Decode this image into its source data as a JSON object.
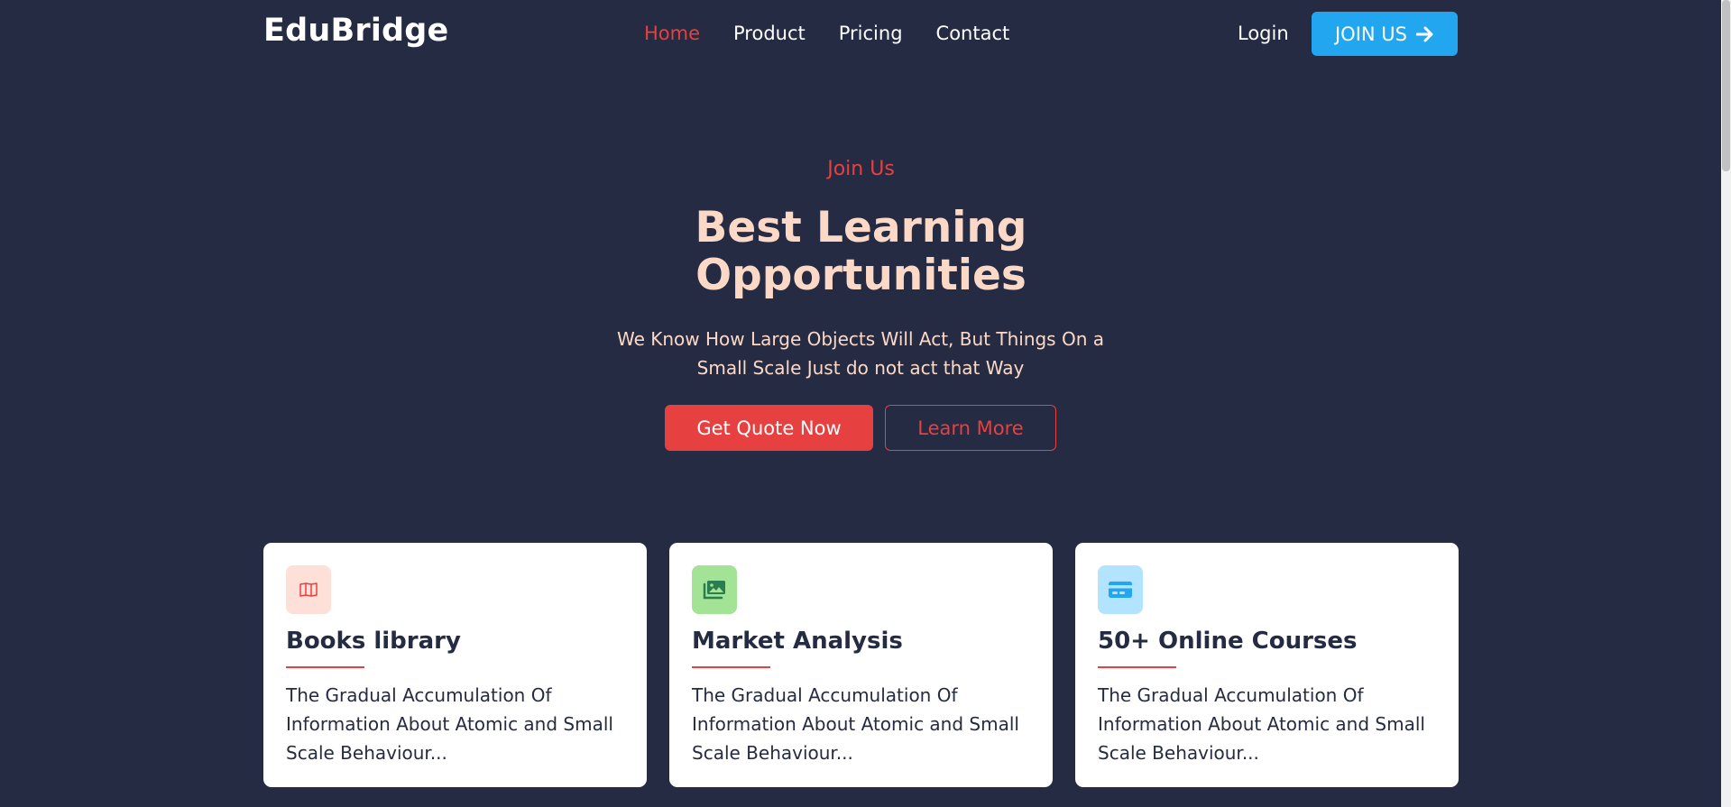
{
  "header": {
    "brand": "EduBridge",
    "nav": [
      "Home",
      "Product",
      "Pricing",
      "Contact"
    ],
    "active_nav": "Home",
    "login_label": "Login",
    "join_label": "JOIN US"
  },
  "hero": {
    "eyebrow": "Join Us",
    "title_line1": "Best Learning",
    "title_line2": "Opportunities",
    "subtitle_line1": "We Know How Large Objects Will Act, But Things On a",
    "subtitle_line2": "Small Scale Just do not act that Way",
    "primary_button": "Get Quote Now",
    "secondary_button": "Learn More"
  },
  "cards": [
    {
      "icon": "book-icon",
      "title": "Books library",
      "text_line1": "The Gradual Accumulation Of",
      "text_line2": "Information About Atomic and Small",
      "text_line3": "Scale Behaviour..."
    },
    {
      "icon": "images-icon",
      "title": "Market Analysis",
      "text_line1": "The Gradual Accumulation Of",
      "text_line2": "Information About Atomic and Small",
      "text_line3": "Scale Behaviour..."
    },
    {
      "icon": "credit-card-icon",
      "title": "50+ Online Courses",
      "text_line1": "The Gradual Accumulation Of",
      "text_line2": "Information About Atomic and Small",
      "text_line3": "Scale Behaviour..."
    }
  ],
  "colors": {
    "background": "#252b42",
    "accent_red": "#e74040",
    "accent_blue": "#23a6f0",
    "hero_text": "#fcd9c6",
    "icon_bg_red": "#ffe0d8",
    "icon_bg_green": "#a2e396",
    "icon_bg_blue": "#b2e3ff"
  }
}
